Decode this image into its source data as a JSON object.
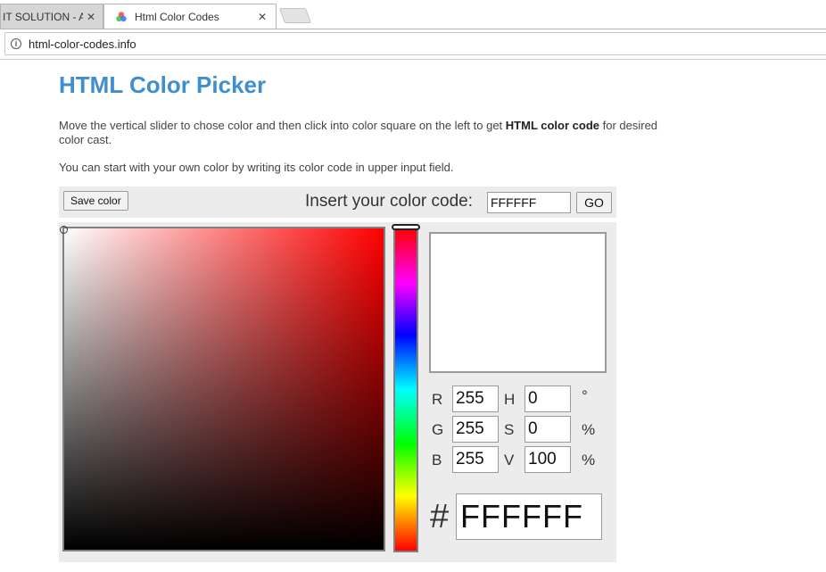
{
  "browser": {
    "tabs": [
      {
        "title": "IT SOLUTION - A",
        "active": false
      },
      {
        "title": "Html Color Codes",
        "active": true
      }
    ],
    "close_symbol": "✕",
    "url": "html-color-codes.info"
  },
  "page": {
    "title": "HTML Color Picker",
    "intro_part1": "Move the vertical slider to chose color and then click into color square on the left to get ",
    "intro_bold": "HTML color code",
    "intro_part2": " for desired color cast.",
    "intro2": "You can start with your own color by writing its color code in upper input field."
  },
  "toolbar": {
    "save_label": "Save color",
    "insert_label": "Insert your color code:",
    "code_value": "FFFFFF",
    "go_label": "GO"
  },
  "picker": {
    "hue_color": "#FF0000",
    "preview_color": "#FFFFFF",
    "labels": {
      "r": "R",
      "g": "G",
      "b": "B",
      "h": "H",
      "s": "S",
      "v": "V"
    },
    "rgb": {
      "r": "255",
      "g": "255",
      "b": "255"
    },
    "hsv": {
      "h": "0",
      "s": "0",
      "v": "100"
    },
    "units": {
      "h": "°",
      "s": "%",
      "v": "%"
    },
    "hash": "#",
    "hex": "FFFFFF"
  },
  "colors": {
    "title_blue": "#3E8ED0",
    "panel_gray": "#ECECEC"
  }
}
